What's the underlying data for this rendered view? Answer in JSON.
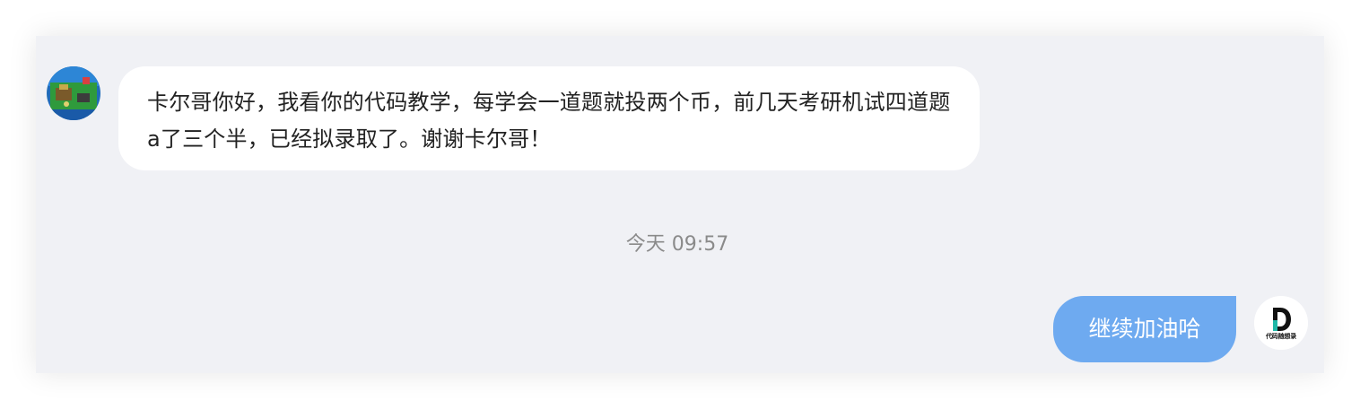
{
  "messages": {
    "incoming": {
      "text": "卡尔哥你好，我看你的代码教学，每学会一道题就投两个币，前几天考研机试四道题a了三个半，已经拟录取了。谢谢卡尔哥！"
    },
    "timestamp": "今天 09:57",
    "outgoing": {
      "text": "继续加油哈"
    }
  },
  "avatars": {
    "left": {
      "icon": "game-scene-avatar-icon"
    },
    "right": {
      "icon": "code-logo-icon",
      "logo_letter": "D",
      "logo_caption": "代码随想录"
    }
  },
  "colors": {
    "chat_background": "#f0f1f5",
    "incoming_bubble": "#ffffff",
    "outgoing_bubble": "#6eaaf0",
    "timestamp_text": "#8a8a8a"
  }
}
